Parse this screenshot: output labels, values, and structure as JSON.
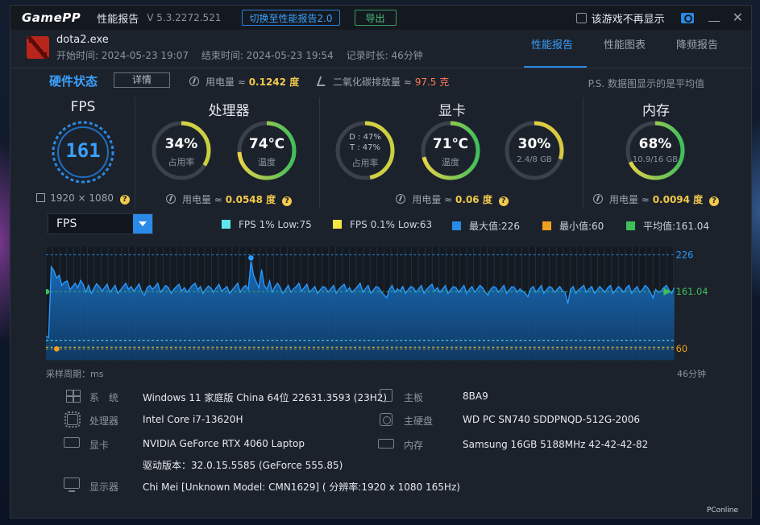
{
  "titlebar": {
    "logo": "GamePP",
    "title": "性能报告",
    "version": "V 5.3.2272.521",
    "switch_button": "切换至性能报告2.0",
    "export_button": "导出",
    "no_display_label": "该游戏不再显示"
  },
  "game": {
    "name": "dota2.exe",
    "start": "开始时间: 2024-05-23 19:07",
    "end": "结束时间: 2024-05-23 19:54",
    "duration": "记录时长: 46分钟"
  },
  "tabs": [
    "性能报告",
    "性能图表",
    "降频报告"
  ],
  "status": {
    "title": "硬件状态",
    "detail_button": "详情",
    "electricity_label": "用电量 ≈",
    "electricity_value": "0.1242 度",
    "co2_label": "二氧化碳排放量 ≈",
    "co2_value": "97.5 克",
    "note": "P.S. 数据图显示的是平均值"
  },
  "fps_panel": {
    "title": "FPS",
    "value": "161",
    "resolution": "1920 × 1080"
  },
  "cpu_panel": {
    "title": "处理器",
    "usage_value": "34%",
    "usage_label": "占用率",
    "usage_fraction": 0.34,
    "temp_value": "74℃",
    "temp_label": "温度",
    "temp_fraction": 0.74,
    "power_label": "用电量 ≈",
    "power_value": "0.0548 度"
  },
  "gpu_panel": {
    "title": "显卡",
    "usage_d": "D : 47%",
    "usage_t": "T : 47%",
    "usage_label": "占用率",
    "usage_fraction": 0.47,
    "temp_value": "71℃",
    "temp_label": "温度",
    "temp_fraction": 0.71,
    "vram_value": "30%",
    "vram_sub": "2.4/8 GB",
    "vram_fraction": 0.3,
    "power_label": "用电量 ≈",
    "power_value": "0.06 度"
  },
  "mem_panel": {
    "title": "内存",
    "usage_value": "68%",
    "usage_sub": "10.9/16 GB",
    "usage_fraction": 0.68,
    "power_label": "用电量 ≈",
    "power_value": "0.0094 度"
  },
  "chart_controls": {
    "selected": "FPS",
    "legend": [
      {
        "label": "FPS 1% Low:75",
        "color": "#5ee6f0"
      },
      {
        "label": "FPS 0.1% Low:63",
        "color": "#f5e642"
      },
      {
        "label": "最大值:226",
        "color": "#2a8ae8"
      },
      {
        "label": "最小值:60",
        "color": "#f0a020"
      },
      {
        "label": "平均值:161.04",
        "color": "#3fbf5a"
      }
    ],
    "x_left_label": "采样周期：ms",
    "x_right_label": "46分钟"
  },
  "chart_data": {
    "type": "area",
    "series": [
      {
        "name": "FPS",
        "values": [
          82,
          80,
          205,
          198,
          185,
          190,
          172,
          178,
          180,
          165,
          170,
          176,
          168,
          181,
          174,
          160,
          172,
          158,
          166,
          175,
          170,
          162,
          168,
          174,
          160,
          166,
          172,
          158,
          164,
          170,
          176,
          165,
          170,
          162,
          168,
          175,
          160,
          155,
          168,
          172,
          165,
          170,
          176,
          160,
          166,
          172,
          168,
          158,
          165,
          170,
          174,
          162,
          168,
          160,
          166,
          172,
          176,
          164,
          170,
          158,
          165,
          171,
          167,
          160,
          168,
          174,
          162,
          166,
          170,
          158,
          164,
          170,
          176,
          160,
          168,
          172,
          165,
          215,
          190,
          178,
          168,
          200,
          172,
          165,
          180,
          160,
          170,
          176,
          168,
          158,
          165,
          172,
          160,
          166,
          170,
          176,
          162,
          168,
          174,
          160,
          165,
          170,
          158,
          164,
          170,
          168,
          160,
          166,
          172,
          158,
          165,
          170,
          174,
          162,
          168,
          160,
          165,
          170,
          176,
          160,
          166,
          172,
          158,
          164,
          170,
          168,
          160,
          155,
          150,
          165,
          172,
          160,
          166,
          162,
          170,
          158,
          164,
          170,
          168,
          160,
          166,
          172,
          158,
          165,
          170,
          174,
          162,
          168,
          160,
          166,
          172,
          158,
          164,
          170,
          168,
          160,
          166,
          172,
          158,
          165,
          170,
          160,
          166,
          172,
          168,
          160,
          155,
          165,
          170,
          168,
          160,
          166,
          172,
          158,
          164,
          170,
          168,
          160,
          166,
          162,
          158,
          152,
          166,
          170,
          160,
          165,
          172,
          158,
          164,
          170,
          168,
          160,
          165,
          170,
          162,
          160,
          140,
          165,
          170,
          158,
          164,
          168,
          172,
          160,
          166,
          170,
          158,
          164,
          170,
          165,
          160,
          168,
          172,
          158,
          164,
          170,
          166,
          160,
          168,
          172,
          158,
          165,
          170,
          160,
          164,
          172,
          168,
          160,
          150,
          165,
          160,
          162,
          168,
          172,
          164,
          158,
          168
        ]
      }
    ],
    "reference_lines": {
      "max": 226,
      "avg": 161.04,
      "min": 60,
      "low1": 75,
      "low01": 63
    },
    "right_labels": [
      "226",
      "161.04",
      "60"
    ],
    "ylim": [
      40,
      240
    ]
  },
  "sysinfo": {
    "os_label": "系　统",
    "os_value": "Windows 11 家庭版 China 64位 22631.3593 (23H2)",
    "cpu_label": "处理器",
    "cpu_value": "Intel Core i7-13620H",
    "gpu_label": "显卡",
    "gpu_value": "NVIDIA GeForce RTX 4060 Laptop",
    "driver_value": "驱动版本：32.0.15.5585 (GeForce 555.85)",
    "monitor_label": "显示器",
    "monitor_value": "Chi Mei [Unknown Model: CMN1629] ( 分辨率:1920 x 1080 165Hz)",
    "board_label": "主板",
    "board_value": "8BA9",
    "disk_label": "主硬盘",
    "disk_value": "WD PC SN740 SDDPNQD-512G-2006",
    "ram_label": "内存",
    "ram_value": "Samsung 16GB 5188MHz 42-42-42-82"
  },
  "watermark": "PConline"
}
